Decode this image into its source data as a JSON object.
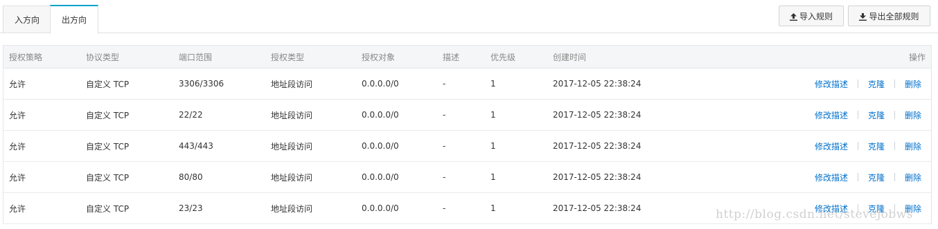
{
  "tabs": [
    {
      "label": "入方向"
    },
    {
      "label": "出方向"
    }
  ],
  "toolbar": {
    "import_label": "导入规则",
    "export_label": "导出全部规则"
  },
  "table": {
    "headers": [
      "授权策略",
      "协议类型",
      "端口范围",
      "授权类型",
      "授权对象",
      "描述",
      "优先级",
      "创建时间",
      "操作"
    ],
    "rows": [
      {
        "policy": "允许",
        "protocol": "自定义 TCP",
        "port": "3306/3306",
        "auth_type": "地址段访问",
        "target": "0.0.0.0/0",
        "desc": "-",
        "priority": "1",
        "created": "2017-12-05 22:38:24"
      },
      {
        "policy": "允许",
        "protocol": "自定义 TCP",
        "port": "22/22",
        "auth_type": "地址段访问",
        "target": "0.0.0.0/0",
        "desc": "-",
        "priority": "1",
        "created": "2017-12-05 22:38:24"
      },
      {
        "policy": "允许",
        "protocol": "自定义 TCP",
        "port": "443/443",
        "auth_type": "地址段访问",
        "target": "0.0.0.0/0",
        "desc": "-",
        "priority": "1",
        "created": "2017-12-05 22:38:24"
      },
      {
        "policy": "允许",
        "protocol": "自定义 TCP",
        "port": "80/80",
        "auth_type": "地址段访问",
        "target": "0.0.0.0/0",
        "desc": "-",
        "priority": "1",
        "created": "2017-12-05 22:38:24"
      },
      {
        "policy": "允许",
        "protocol": "自定义 TCP",
        "port": "23/23",
        "auth_type": "地址段访问",
        "target": "0.0.0.0/0",
        "desc": "-",
        "priority": "1",
        "created": "2017-12-05 22:38:24"
      }
    ],
    "actions": {
      "edit": "修改描述",
      "clone": "克隆",
      "delete": "删除"
    }
  },
  "watermark": "http://blog.csdn.net/stevejobws",
  "colors": {
    "accent": "#00a2ca",
    "link": "#0070cc"
  },
  "icons": {
    "import": "upload-icon",
    "export": "download-icon"
  }
}
